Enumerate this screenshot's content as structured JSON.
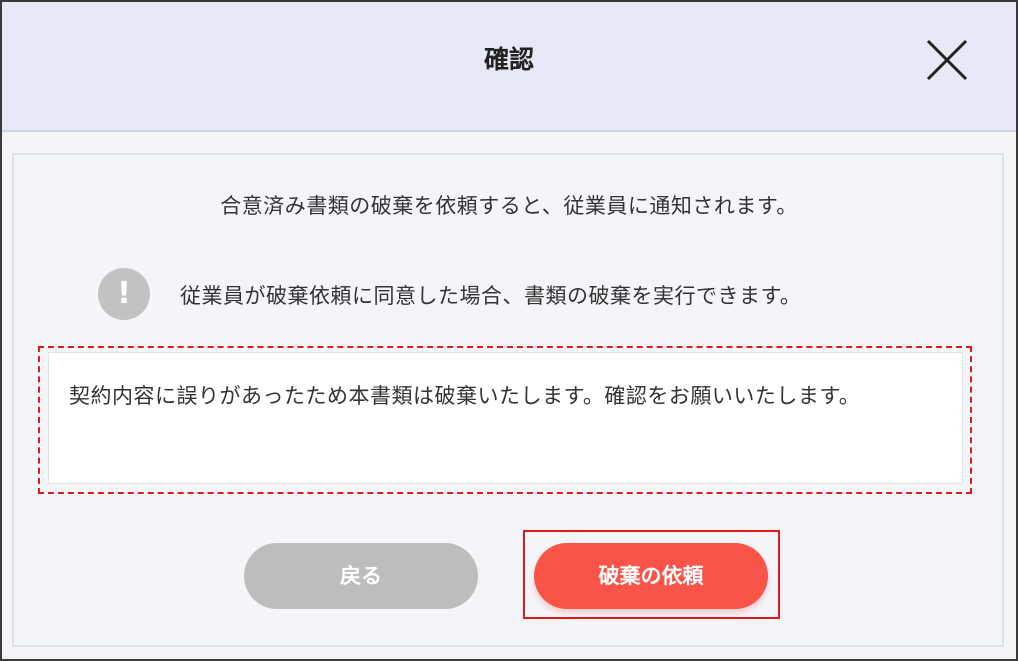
{
  "dialog": {
    "title": "確認",
    "close_icon": "close-icon",
    "message": "合意済み書類の破棄を依頼すると、従業員に通知されます。",
    "notice": {
      "icon": "exclamation-icon",
      "icon_glyph": "!",
      "text": "従業員が破棄依頼に同意した場合、書類の破棄を実行できます。"
    },
    "comment": "契約内容に誤りがあったため本書類は破棄いたします。確認をお願いいたします。",
    "buttons": {
      "back": "戻る",
      "request": "破棄の依頼"
    }
  },
  "colors": {
    "header_bg": "#e7e9f6",
    "body_bg": "#f3f4f8",
    "primary_button": "#f8544a",
    "secondary_button": "#bdbdbd",
    "highlight": "#e01b1b"
  }
}
